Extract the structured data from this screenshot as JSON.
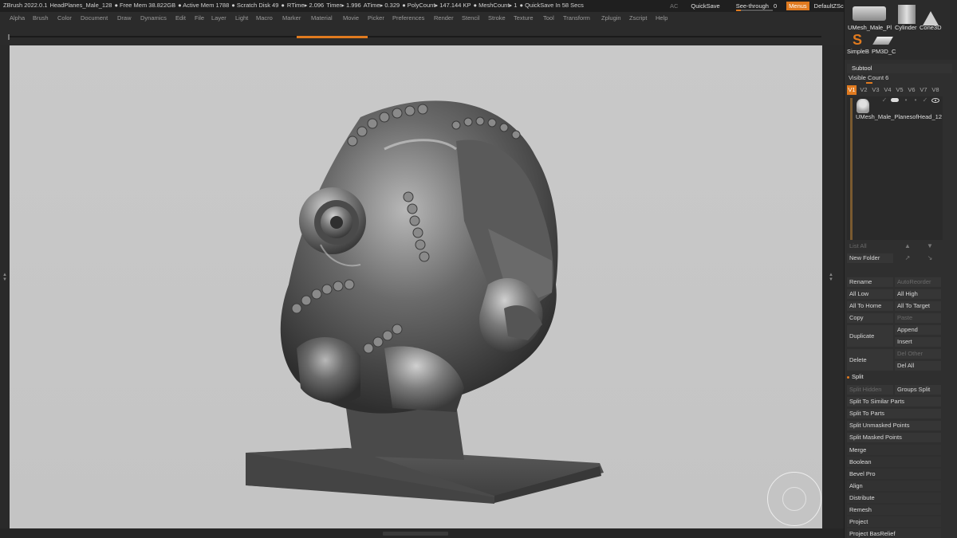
{
  "titlebar": {
    "status": [
      "ZBrush 2022.0.1",
      "HeadPlanes_Male_128",
      "● Free Mem 38.822GB",
      "● Active Mem 1788",
      "● Scratch Disk 49",
      "●",
      "RTime▸ 2.096",
      "Timer▸ 1.996",
      "ATime▸ 0.329",
      "● PolyCount▸ 147.144 KP",
      "● MeshCount▸ 1",
      "● QuickSave In 58 Secs"
    ],
    "ac": "AC",
    "quicksave": "QuickSave",
    "see_through_label": "See-through",
    "see_through_value": "0",
    "see_through_level": 0,
    "menus": "Menus",
    "script": "DefaultZScript"
  },
  "menu": [
    "Alpha",
    "Brush",
    "Color",
    "Document",
    "Draw",
    "Dynamics",
    "Edit",
    "File",
    "Layer",
    "Light",
    "Macro",
    "Marker",
    "Material",
    "Movie",
    "Picker",
    "Preferences",
    "Render",
    "Stencil",
    "Stroke",
    "Texture",
    "Tool",
    "Transform",
    "Zplugin",
    "Zscript",
    "Help"
  ],
  "thumbs": {
    "t1": "UMesh_Male_Pl",
    "t2": "Cylinder",
    "t3": "Cone3D",
    "t4": "SimpleB",
    "t5": "PM3D_C"
  },
  "subtool": {
    "title": "Subtool",
    "visible_count": "Visible Count 6",
    "tabs": [
      "V1",
      "V2",
      "V3",
      "V4",
      "V5",
      "V6",
      "V7",
      "V8"
    ],
    "active_tab": "V1",
    "item_label": "UMesh_Male_PlanesofHead_12",
    "list_all": "List All",
    "new_folder": "New Folder"
  },
  "buttons": {
    "rename": "Rename",
    "autoreorder": "AutoReorder",
    "all_low": "All Low",
    "all_high": "All High",
    "all_to_home": "All To Home",
    "all_to_target": "All To Target",
    "copy": "Copy",
    "paste": "Paste",
    "duplicate": "Duplicate",
    "append": "Append",
    "insert": "Insert",
    "delete": "Delete",
    "del_other": "Del Other",
    "del_all": "Del All"
  },
  "split": {
    "title": "Split",
    "split_hidden": "Split Hidden",
    "groups_split": "Groups Split",
    "similar": "Split To Similar Parts",
    "parts": "Split To Parts",
    "unmasked": "Split Unmasked Points",
    "masked": "Split Masked Points"
  },
  "menus": [
    "Merge",
    "Boolean",
    "Bevel Pro",
    "Align",
    "Distribute",
    "Remesh",
    "Project",
    "Project BasRelief"
  ],
  "colors": {
    "accent": "#e07a1f",
    "viewport_bg": "#c7c7c7",
    "panel_bg": "#2f2f2f"
  }
}
